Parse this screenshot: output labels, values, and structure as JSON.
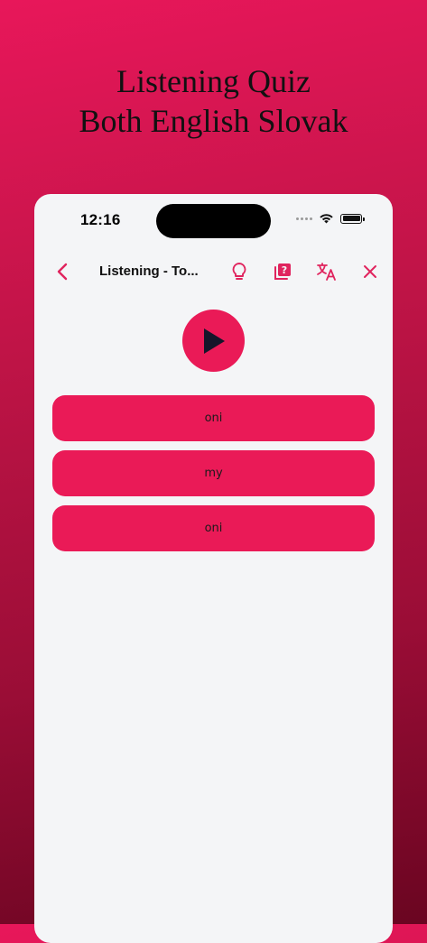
{
  "promo": {
    "line1": "Listening Quiz",
    "line2": "Both English Slovak"
  },
  "status_bar": {
    "time": "12:16"
  },
  "navbar": {
    "title": "Listening - To...",
    "icons": [
      "back-chevron-icon",
      "lightbulb-icon",
      "question-cards-icon",
      "translate-icon",
      "close-icon"
    ]
  },
  "player": {
    "icon": "play-icon"
  },
  "answers": [
    {
      "label": "oni"
    },
    {
      "label": "my"
    },
    {
      "label": "oni"
    }
  ],
  "colors": {
    "accent": "#ea1a57",
    "background": "#f4f5f7",
    "gradient_top": "#e8175a",
    "gradient_bottom": "#6a0521"
  }
}
